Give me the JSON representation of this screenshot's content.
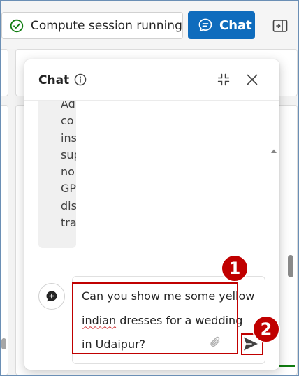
{
  "toolbar": {
    "status_label": "Compute session running",
    "chat_label": "Chat",
    "status_color": "#107c10",
    "chat_button_color": "#0f6cbd",
    "icons": {
      "status": "check-circle-icon",
      "chat": "chat-bubble-icon",
      "panel": "panel-toggle-icon"
    }
  },
  "chat_panel": {
    "title": "Chat",
    "header_icons": [
      "info-icon",
      "collapse-icon",
      "close-icon"
    ],
    "message_fragments": [
      "Ad",
      "co",
      "ins",
      "sup",
      "no",
      "GP",
      "dis",
      "tra"
    ],
    "composer": {
      "lines": [
        "Can you show me some yellow",
        "indian dresses for a wedding",
        "in Udaipur?"
      ],
      "misspelled_word": "indian",
      "icons": [
        "new-chat-icon",
        "attach-icon",
        "send-icon"
      ]
    }
  },
  "annotations": {
    "badge_1": "1",
    "badge_2": "2",
    "color": "#c00000"
  }
}
